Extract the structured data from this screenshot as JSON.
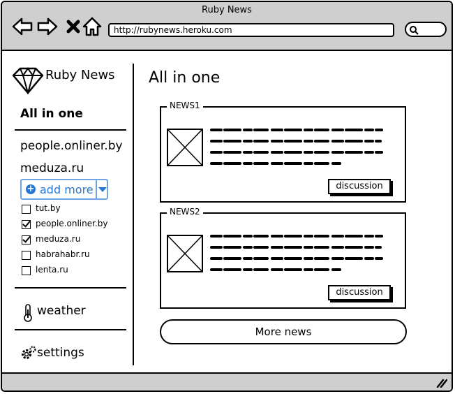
{
  "window": {
    "title": "Ruby News"
  },
  "browser": {
    "url": "http://rubynews.heroku.com"
  },
  "sidebar": {
    "brand": "Ruby News",
    "active": "All in one",
    "sources": [
      "people.onliner.by",
      "meduza.ru"
    ],
    "add_more": "add more",
    "checkboxes": [
      {
        "label": "tut.by",
        "checked": false
      },
      {
        "label": "people.onliner.by",
        "checked": true
      },
      {
        "label": "meduza.ru",
        "checked": true
      },
      {
        "label": "habrahabr.ru",
        "checked": false
      },
      {
        "label": "lenta.ru",
        "checked": false
      }
    ],
    "weather": "weather",
    "settings": "settings"
  },
  "main": {
    "title": "All in one",
    "news": [
      {
        "legend": "NEWS1",
        "button": "discussion"
      },
      {
        "legend": "NEWS2",
        "button": "discussion"
      }
    ],
    "more": "More news"
  },
  "colors": {
    "chrome": "#cfcfcf",
    "accent": "#2778d4"
  }
}
